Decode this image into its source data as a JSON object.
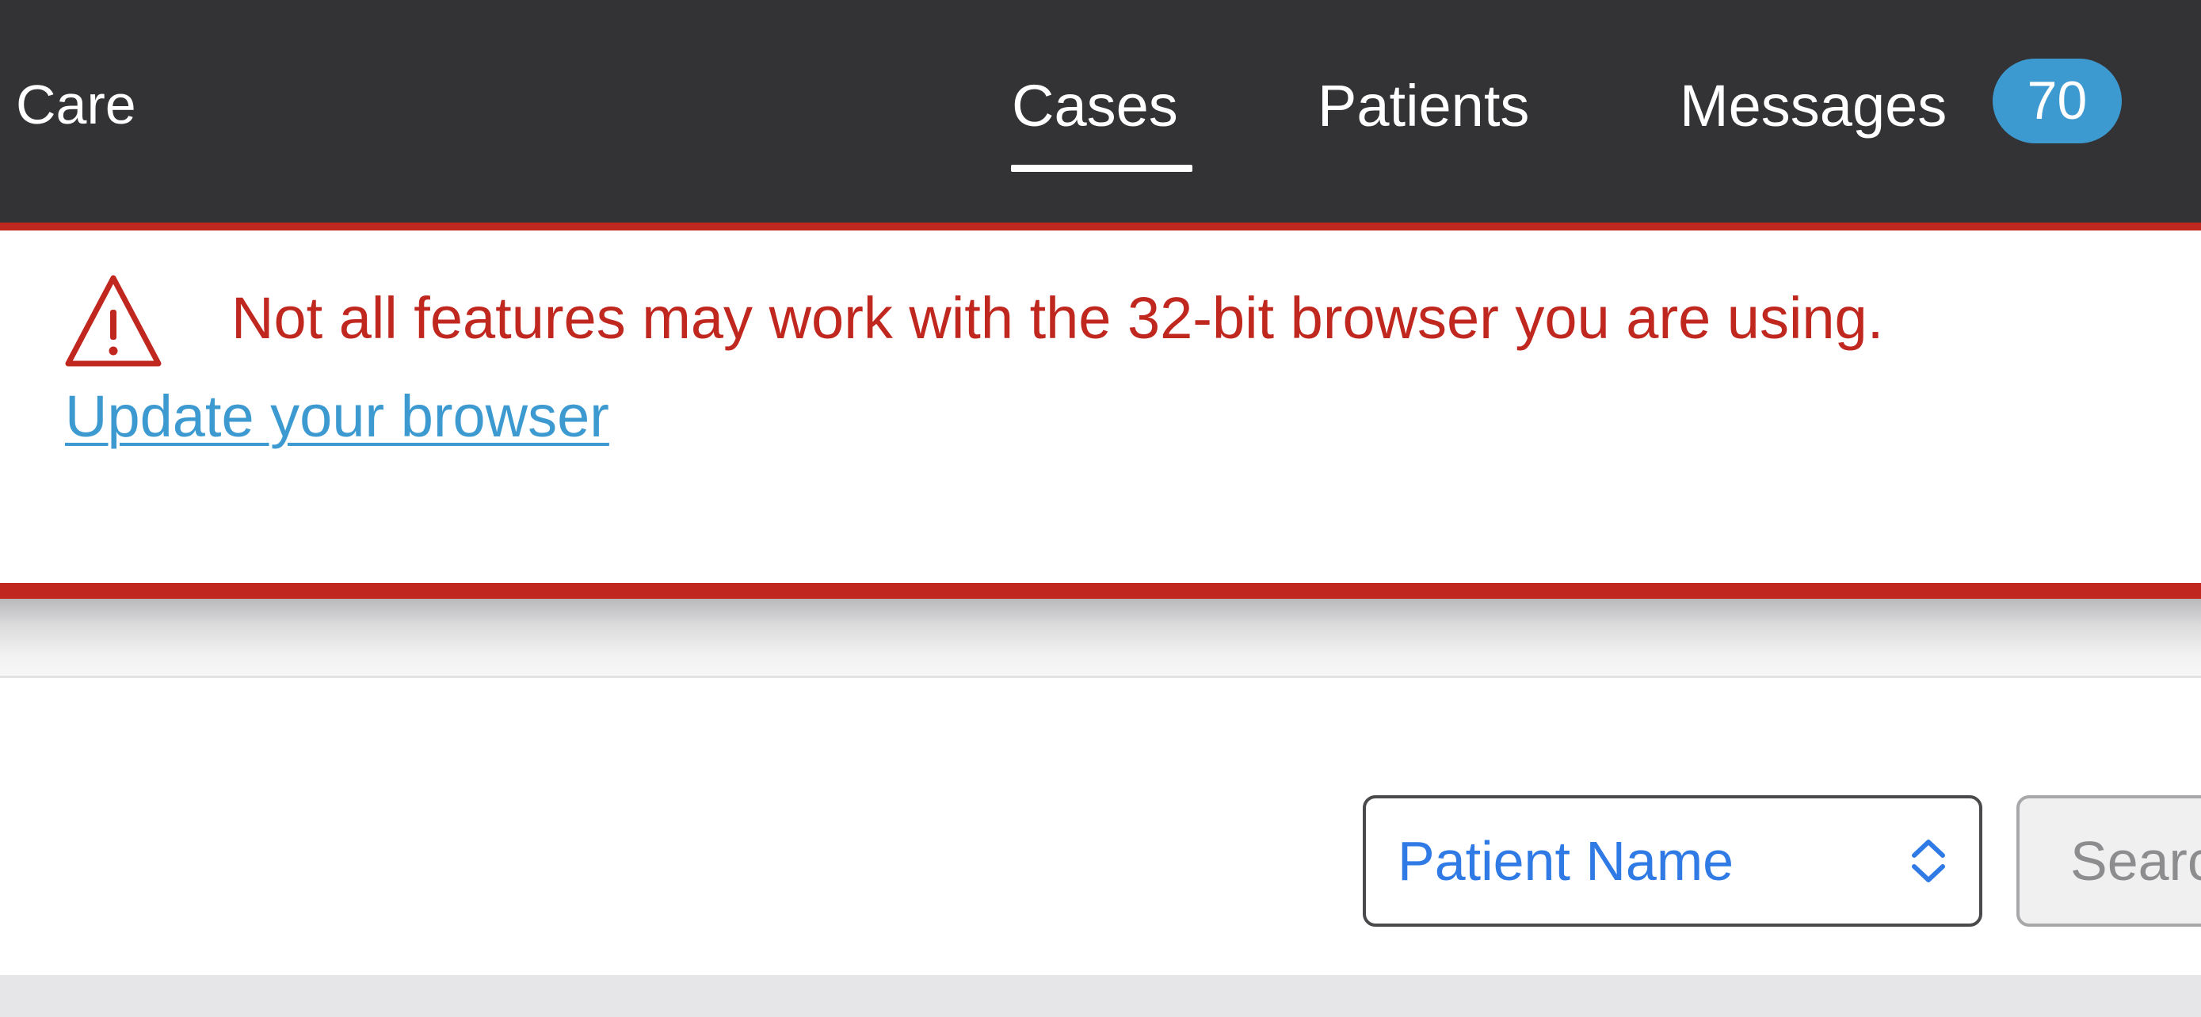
{
  "app": {
    "brand": "Care"
  },
  "nav": {
    "tabs": [
      {
        "label": "Cases",
        "active": true
      },
      {
        "label": "Patients",
        "active": false
      },
      {
        "label": "Messages",
        "active": false,
        "badge": "70"
      }
    ]
  },
  "banner": {
    "icon": "warning-triangle-icon",
    "message": "Not all features may work with the 32-bit browser you are using.",
    "link_label": "Update your browser"
  },
  "filters": {
    "search_by": {
      "selected": "Patient Name",
      "icon": "chevron-up-down-icon"
    },
    "search_button_label": "Searc"
  },
  "colors": {
    "topbar_bg": "#333335",
    "accent_red": "#c0271f",
    "link_blue": "#3d9ad1",
    "select_blue": "#2f7ae5"
  }
}
